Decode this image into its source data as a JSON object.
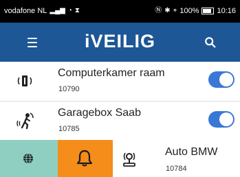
{
  "status_bar": {
    "carrier": "vodafone NL",
    "battery": "100%",
    "time": "10:16"
  },
  "app": {
    "title": "iVEILIG",
    "accent": "#1d5795"
  },
  "items": [
    {
      "name": "Computerkamer raam",
      "code": "10790",
      "enabled": true
    },
    {
      "name": "Garagebox Saab",
      "code": "10785",
      "enabled": true
    },
    {
      "name": "Auto BMW",
      "code": "10784"
    }
  ],
  "bottom_tabs": [
    {
      "icon": "globe-icon",
      "color": "#8ecfc1"
    },
    {
      "icon": "bell-icon",
      "color": "#f48d1a"
    }
  ]
}
